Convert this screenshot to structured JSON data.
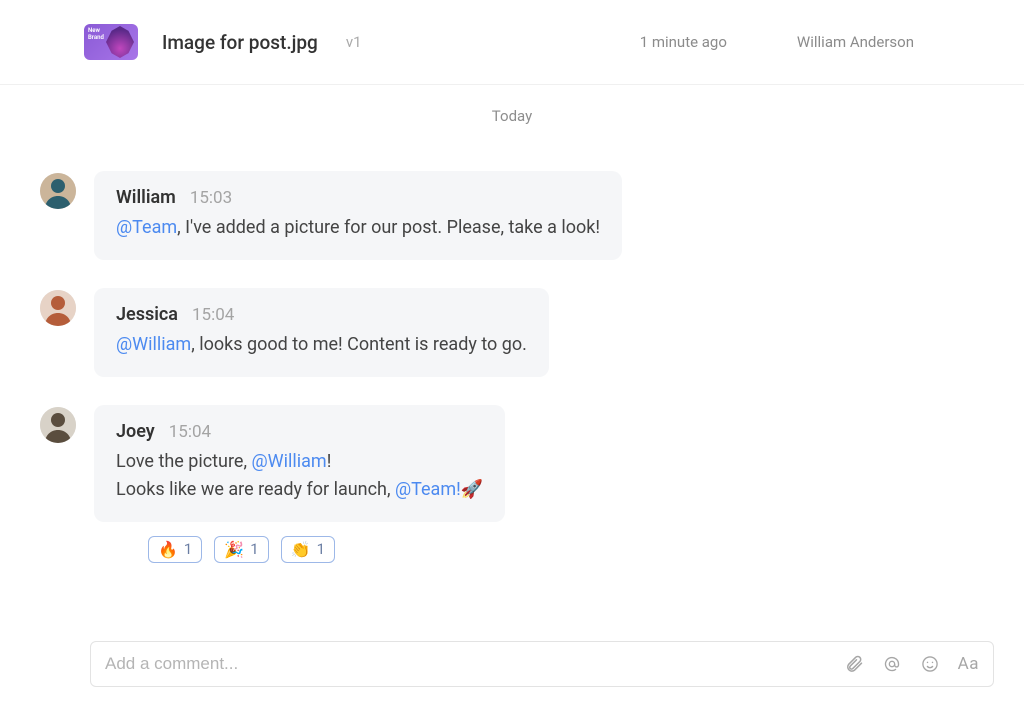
{
  "header": {
    "file_name": "Image for post.jpg",
    "version": "v1",
    "time": "1 minute ago",
    "owner": "William Anderson"
  },
  "day_label": "Today",
  "messages": [
    {
      "author": "William",
      "time": "15:03",
      "segments": [
        {
          "text": "@Team",
          "mention": true
        },
        {
          "text": ", I've added a picture for our post. Please, take a look!"
        }
      ]
    },
    {
      "author": "Jessica",
      "time": "15:04",
      "segments": [
        {
          "text": "@William",
          "mention": true
        },
        {
          "text": ", looks good to me! Content is ready to go."
        }
      ]
    },
    {
      "author": "Joey",
      "time": "15:04",
      "segments": [
        {
          "text": "Love the picture, "
        },
        {
          "text": "@William",
          "mention": true
        },
        {
          "text": "!"
        },
        {
          "break": true
        },
        {
          "text": "Looks like we are ready for launch, "
        },
        {
          "text": "@Team!",
          "mention": true
        },
        {
          "text": "🚀"
        }
      ],
      "reactions": [
        {
          "emoji": "🔥",
          "count": 1
        },
        {
          "emoji": "🎉",
          "count": 1
        },
        {
          "emoji": "👏",
          "count": 1
        }
      ]
    }
  ],
  "composer": {
    "placeholder": "Add a comment..."
  },
  "icons": {
    "filter": "filter-icon",
    "attachment": "paperclip-icon",
    "mention": "at-icon",
    "emoji": "smiley-icon",
    "format": "format-icon"
  },
  "avatar_colors": {
    "William": {
      "bg": "#cbb59a",
      "body": "#2c5f6e"
    },
    "Jessica": {
      "bg": "#e7d3c6",
      "body": "#b55d3a"
    },
    "Joey": {
      "bg": "#d8d2c8",
      "body": "#5a4d3e"
    }
  }
}
